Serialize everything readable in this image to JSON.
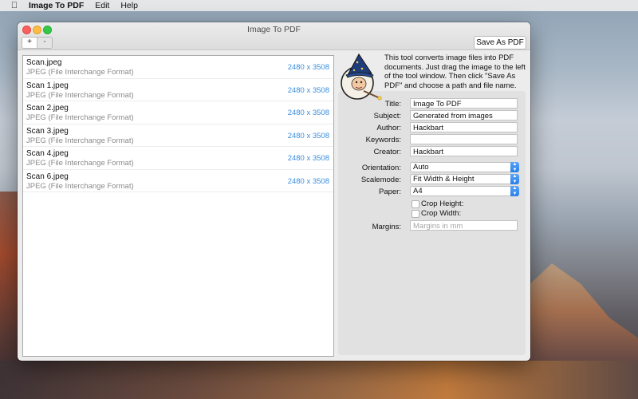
{
  "menubar": {
    "app_name": "Image To PDF",
    "menus": [
      "Edit",
      "Help"
    ]
  },
  "window": {
    "title": "Image To PDF",
    "add_label": "+",
    "remove_label": "-",
    "save_label": "Save As PDF"
  },
  "files": [
    {
      "name": "Scan.jpeg",
      "type": "JPEG (File Interchange Format)",
      "size": "2480 x 3508"
    },
    {
      "name": "Scan 1.jpeg",
      "type": "JPEG (File Interchange Format)",
      "size": "2480 x 3508"
    },
    {
      "name": "Scan 2.jpeg",
      "type": "JPEG (File Interchange Format)",
      "size": "2480 x 3508"
    },
    {
      "name": "Scan 3.jpeg",
      "type": "JPEG (File Interchange Format)",
      "size": "2480 x 3508"
    },
    {
      "name": "Scan 4.jpeg",
      "type": "JPEG (File Interchange Format)",
      "size": "2480 x 3508"
    },
    {
      "name": "Scan 6.jpeg",
      "type": "JPEG (File Interchange Format)",
      "size": "2480 x 3508"
    }
  ],
  "info_text": "This tool converts image files into PDF documents. Just drag the image to the left of the tool window. Then click \"Save As PDF\" and choose a path and file name.",
  "form": {
    "title_label": "Title:",
    "title_value": "Image To PDF",
    "subject_label": "Subject:",
    "subject_value": "Generated from images",
    "author_label": "Author:",
    "author_value": "Hackbart",
    "keywords_label": "Keywords:",
    "keywords_value": "",
    "creator_label": "Creator:",
    "creator_value": "Hackbart",
    "orientation_label": "Orientation:",
    "orientation_value": "Auto",
    "scalemode_label": "Scalemode:",
    "scalemode_value": "Fit Width & Height",
    "paper_label": "Paper:",
    "paper_value": "A4",
    "crop_height_label": "Crop Height:",
    "crop_width_label": "Crop Width:",
    "margins_label": "Margins:",
    "margins_placeholder": "Margins in mm"
  },
  "colors": {
    "accent": "#3a8ee0",
    "close": "#fc605c",
    "minimize": "#fdbc40",
    "maximize": "#34c84a"
  },
  "icons": [
    "apple-icon",
    "wizard-icon",
    "chevron-updown-icon"
  ]
}
